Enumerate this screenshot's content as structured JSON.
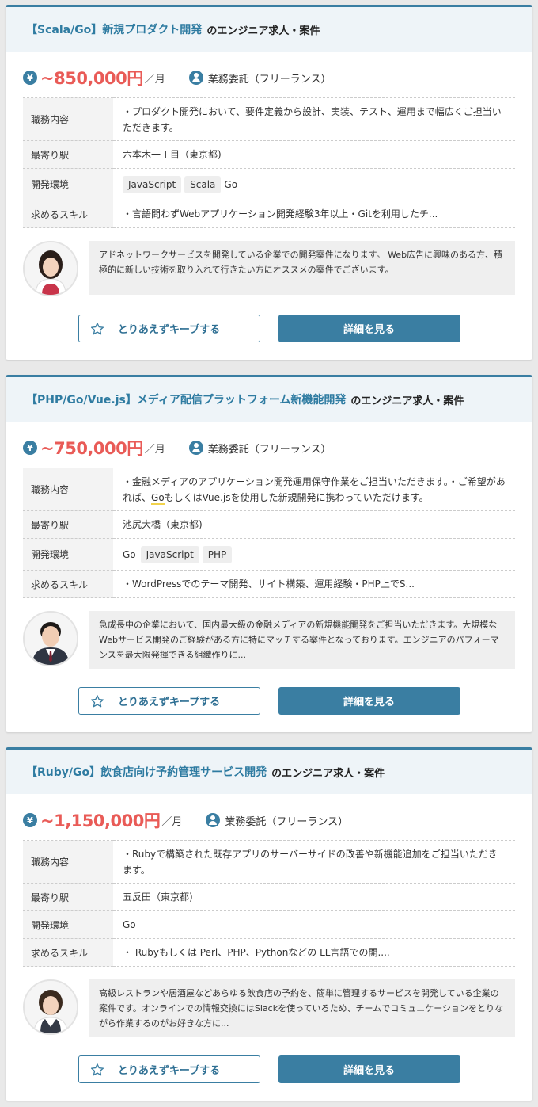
{
  "jobs": [
    {
      "title": "【Scala/Go】新規プロダクト開発",
      "suffix": "のエンジニア求人・案件",
      "yen_icon": "¥",
      "pay": "~850,000円",
      "per": "／月",
      "contract": "業務委託（フリーランス）",
      "rows": [
        {
          "label": "職務内容",
          "value": "・プロダクト開発において、要件定義から設計、実装、テスト、運用まで幅広くご担当いただきます。"
        },
        {
          "label": "最寄り駅",
          "value": "六本木一丁目（東京都)"
        },
        {
          "label": "開発環境",
          "tags": [
            "JavaScript",
            "Scala"
          ],
          "plain": [
            "Go"
          ]
        },
        {
          "label": "求めるスキル",
          "value": "・言語問わずWebアプリケーション開発経験3年以上・Gitを利用したチ..."
        }
      ],
      "comment": "アドネットワークサービスを開発している企業での開発案件になります。 Web広告に興味のある方、積極的に新しい技術を取り入れて行きたい方にオススメの案件でございます。",
      "avatar": "female",
      "keep_label": "とりあえずキープする",
      "detail_label": "詳細を見る"
    },
    {
      "title": "【PHP/Go/Vue.js】メディア配信プラットフォーム新機能開発",
      "suffix": "のエンジニア求人・案件",
      "yen_icon": "¥",
      "pay": "~750,000円",
      "per": "／月",
      "contract": "業務委託（フリーランス）",
      "rows": [
        {
          "label": "職務内容",
          "value_a": "・金融メディアのアプリケーション開発運用保守作業をご担当いただきます。・ご希望があれば、",
          "value_hl": "Go",
          "value_b": "もしくはVue.jsを使用した新規開発に携わっていただけます。"
        },
        {
          "label": "最寄り駅",
          "value": "池尻大橋（東京都)"
        },
        {
          "label": "開発環境",
          "plain": [
            "Go"
          ],
          "tags": [
            "JavaScript",
            "PHP"
          ]
        },
        {
          "label": "求めるスキル",
          "value": "・WordPressでのテーマ開発、サイト構築、運用経験・PHP上でS..."
        }
      ],
      "comment": "急成長中の企業において、国内最大級の金融メディアの新規機能開発をご担当いただきます。大規模なWebサービス開発のご経験がある方に特にマッチする案件となっております。エンジニアのパフォーマンスを最大限発揮できる組織作りに...",
      "avatar": "male",
      "keep_label": "とりあえずキープする",
      "detail_label": "詳細を見る"
    },
    {
      "title": "【Ruby/Go】飲食店向け予約管理サービス開発",
      "suffix": "のエンジニア求人・案件",
      "yen_icon": "¥",
      "pay": "~1,150,000円",
      "per": "／月",
      "contract": "業務委託（フリーランス）",
      "rows": [
        {
          "label": "職務内容",
          "value": "・Rubyで構築された既存アプリのサーバーサイドの改善や新機能追加をご担当いただきます。"
        },
        {
          "label": "最寄り駅",
          "value": "五反田（東京都)"
        },
        {
          "label": "開発環境",
          "plain": [
            "Go"
          ],
          "tags": []
        },
        {
          "label": "求めるスキル",
          "value": "・ Rubyもしくは Perl、PHP、Pythonなどの LL言語での開...."
        }
      ],
      "comment": "高級レストランや居酒屋などあらゆる飲食店の予約を、簡単に管理するサービスを開発している企業の案件です。オンラインでの情報交換にはSlackを使っているため、チームでコミュニケーションをとりながら作業するのがお好きな方に...",
      "avatar": "female2",
      "keep_label": "とりあえずキープする",
      "detail_label": "詳細を見る"
    }
  ],
  "colors": {
    "accent": "#3a7ea2",
    "pay": "#e95b57",
    "header_bg": "#eef4f8"
  },
  "icons": {
    "yen": "yen-icon",
    "person": "person-icon",
    "star": "star-icon"
  }
}
